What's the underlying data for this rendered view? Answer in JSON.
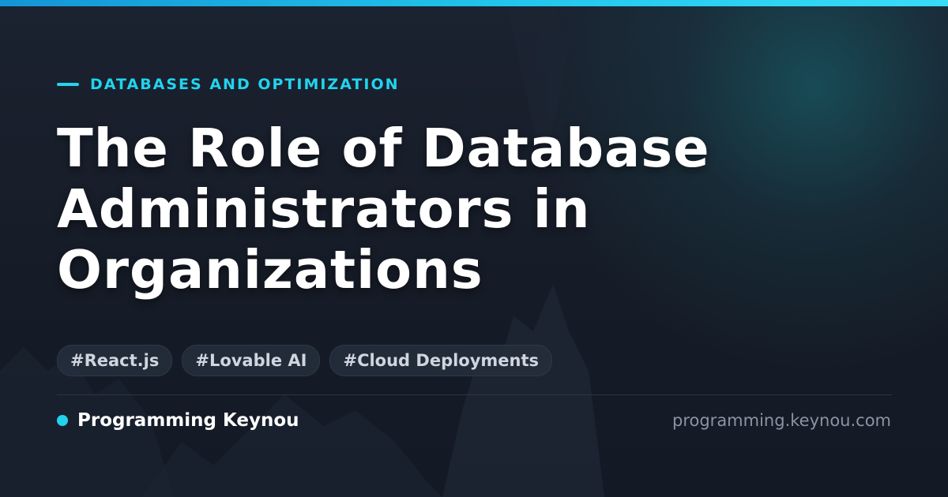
{
  "colors": {
    "accent": "#22d3ee",
    "background": "#161d28",
    "title": "#ffffff",
    "tag_text": "#cfd6e0",
    "domain_text": "#8a94a3"
  },
  "category": "DATABASES AND OPTIMIZATION",
  "title_lines": [
    "The Role of Database",
    "Administrators in",
    "Organizations"
  ],
  "tags": [
    "#React.js",
    "#Lovable AI",
    "#Cloud Deployments"
  ],
  "brand": {
    "name": "Programming Keynou",
    "domain": "programming.keynou.com"
  }
}
